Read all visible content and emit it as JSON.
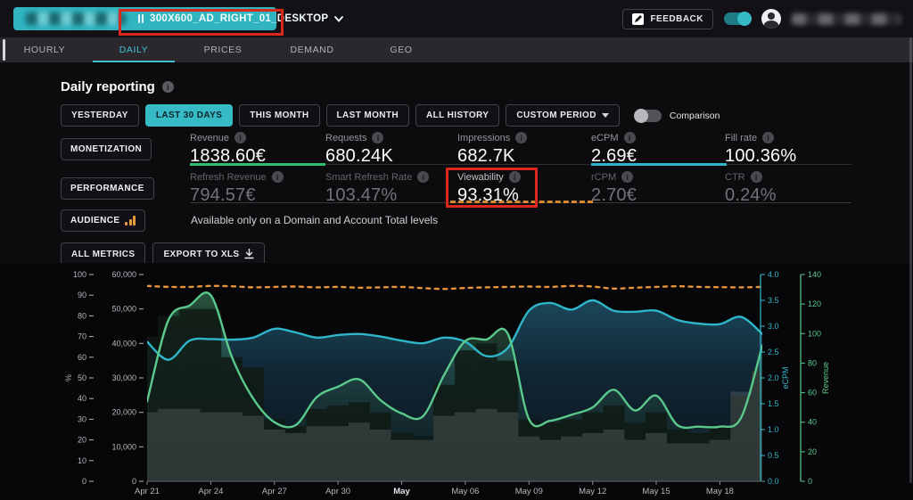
{
  "topbar": {
    "unit_label": "300X600_AD_RIGHT_01_DESKTOP",
    "feedback_label": "FEEDBACK"
  },
  "tabs": [
    {
      "label": "HOURLY"
    },
    {
      "label": "DAILY"
    },
    {
      "label": "PRICES"
    },
    {
      "label": "DEMAND"
    },
    {
      "label": "GEO"
    }
  ],
  "report": {
    "title": "Daily reporting",
    "period_buttons": [
      "YESTERDAY",
      "LAST 30 DAYS",
      "THIS MONTH",
      "LAST MONTH",
      "ALL HISTORY",
      "CUSTOM PERIOD"
    ],
    "active_period": "LAST 30 DAYS",
    "comparison_label": "Comparison"
  },
  "metrics": {
    "rows": [
      {
        "group": "MONETIZATION",
        "items": [
          {
            "label": "Revenue",
            "value": "1838.60€"
          },
          {
            "label": "Requests",
            "value": "680.24K"
          },
          {
            "label": "Impressions",
            "value": "682.7K"
          },
          {
            "label": "eCPM",
            "value": "2.69€"
          },
          {
            "label": "Fill rate",
            "value": "100.36%"
          }
        ]
      },
      {
        "group": "PERFORMANCE",
        "items": [
          {
            "label": "Refresh Revenue",
            "value": "794.57€"
          },
          {
            "label": "Smart Refresh Rate",
            "value": "103.47%"
          },
          {
            "label": "Viewability",
            "value": "93.31%"
          },
          {
            "label": "rCPM",
            "value": "2.70€"
          },
          {
            "label": "CTR",
            "value": "0.24%"
          }
        ]
      }
    ],
    "audience": {
      "group": "AUDIENCE",
      "message": "Available only on a Domain and Account Total levels"
    }
  },
  "actions": {
    "all_metrics": "ALL METRICS",
    "export": "EXPORT TO XLS"
  },
  "colors": {
    "accent_teal": "#35bac6",
    "line_teal": "#2fb6ca",
    "line_green": "#5bc98c",
    "line_orange": "#e8923c",
    "underline_green": "#2dc06e",
    "annotation_red": "#da291c"
  },
  "chart_data": {
    "type": "combo",
    "n_points": 30,
    "x_label_step": 3,
    "x_labels": [
      "Apr 21",
      "Apr 24",
      "Apr 27",
      "Apr 30",
      "May",
      "May 06",
      "May 09",
      "May 12",
      "May 15",
      "May 18"
    ],
    "x_bold_label": "May",
    "axes": {
      "pct": {
        "label": "%",
        "min": 0,
        "max": 100,
        "step": 10,
        "color": "#b6b4b8",
        "thousands": false,
        "decimals": 0
      },
      "count": {
        "label": "",
        "min": 0,
        "max": 60000,
        "step": 10000,
        "color": "#b6b4b8",
        "thousands": true,
        "decimals": 0
      },
      "ecpm": {
        "label": "eCPM",
        "min": 0,
        "max": 4,
        "step": 0.5,
        "color": "#36b7c9",
        "thousands": false,
        "decimals": 1
      },
      "revenue": {
        "label": "Revenue",
        "min": 0,
        "max": 140,
        "step": 20,
        "color": "#5bc98c",
        "thousands": false,
        "decimals": 0
      }
    },
    "series": [
      {
        "name": "eCPM",
        "type": "area-line",
        "axis": "ecpm",
        "color": "#2fb6ca",
        "fill": "url(#fillTeal)",
        "values": [
          2.7,
          2.35,
          2.72,
          2.75,
          2.74,
          2.78,
          2.95,
          2.88,
          2.78,
          2.83,
          2.85,
          2.8,
          2.72,
          2.67,
          2.78,
          2.7,
          2.42,
          2.58,
          3.3,
          3.45,
          3.32,
          3.5,
          3.3,
          3.28,
          3.3,
          3.12,
          3.05,
          3.04,
          3.18,
          2.85
        ]
      },
      {
        "name": "Revenue",
        "type": "area-line",
        "axis": "revenue",
        "color": "#5bc98c",
        "fill": "url(#fillGreen)",
        "values": [
          54,
          109,
          119,
          126,
          84,
          56,
          40,
          38,
          57,
          64,
          69,
          55,
          46,
          44,
          72,
          95,
          96,
          100,
          42,
          41,
          45,
          50,
          62,
          48,
          58,
          38,
          37,
          37,
          43,
          92
        ]
      },
      {
        "name": "Requests",
        "type": "bar",
        "axis": "count",
        "color": "rgba(15,26,20,0.85)",
        "values": [
          42000,
          48000,
          50000,
          50000,
          36000,
          33000,
          18000,
          16000,
          21000,
          22000,
          23000,
          20000,
          14000,
          13000,
          28000,
          38000,
          40000,
          35000,
          18000,
          17000,
          18000,
          20000,
          22000,
          17000,
          20000,
          15000,
          14000,
          16000,
          25000,
          32000
        ]
      },
      {
        "name": "Impressions",
        "type": "bar",
        "axis": "count",
        "color": "rgba(200,206,220,0.17)",
        "values": [
          20000,
          21000,
          21000,
          20000,
          20000,
          19000,
          15000,
          14000,
          16000,
          16000,
          17000,
          15000,
          12000,
          12000,
          19000,
          20000,
          21000,
          20000,
          13000,
          12000,
          13000,
          14000,
          15000,
          12000,
          14000,
          11000,
          11000,
          12000,
          26000,
          32000
        ]
      },
      {
        "name": "Viewability",
        "type": "dashed-line",
        "axis": "pct",
        "color": "#e8923c",
        "values": [
          94.5,
          94,
          94,
          94.5,
          94.3,
          93.8,
          94,
          94.2,
          93.8,
          94,
          93.6,
          93.8,
          94,
          93.4,
          93,
          93.5,
          93.8,
          94,
          94.2,
          94,
          94.5,
          94.2,
          93.2,
          93.6,
          94,
          94.3,
          94,
          93.9,
          93.8,
          94
        ]
      }
    ]
  }
}
